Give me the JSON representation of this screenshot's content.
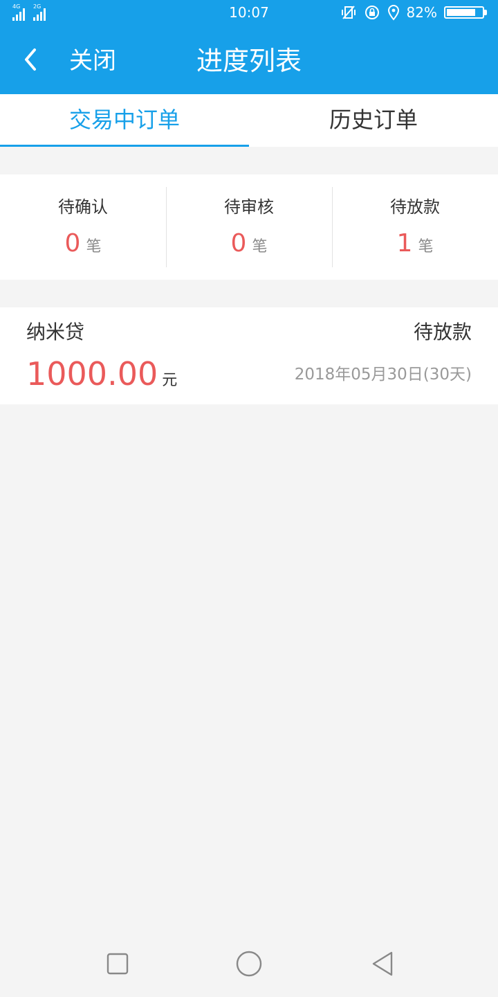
{
  "status_bar": {
    "network_1": "4G",
    "network_2": "2G",
    "time": "10:07",
    "battery_text": "82%",
    "battery_level": 0.82,
    "icons": [
      "vibrate-icon",
      "rotation-lock-icon",
      "location-icon",
      "battery-icon"
    ]
  },
  "header": {
    "close_label": "关闭",
    "title": "进度列表"
  },
  "tabs": [
    {
      "label": "交易中订单",
      "active": true
    },
    {
      "label": "历史订单",
      "active": false
    }
  ],
  "counts": [
    {
      "label": "待确认",
      "value": "0",
      "unit": "笔"
    },
    {
      "label": "待审核",
      "value": "0",
      "unit": "笔"
    },
    {
      "label": "待放款",
      "value": "1",
      "unit": "笔"
    }
  ],
  "order": {
    "name": "纳米贷",
    "status": "待放款",
    "amount": "1000.00",
    "currency": "元",
    "date": "2018年05月30日(30天)"
  },
  "colors": {
    "brand": "#17a0e9",
    "accent_red": "#ea5a5a",
    "background": "#f4f4f4"
  }
}
